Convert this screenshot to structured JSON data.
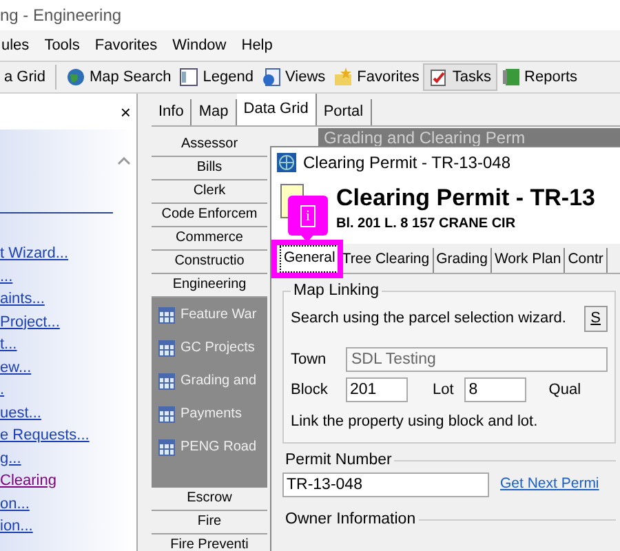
{
  "window": {
    "title": "ng - Engineering"
  },
  "menu": [
    "ules",
    "Tools",
    "Favorites",
    "Window",
    "Help"
  ],
  "toolbar": [
    {
      "label": "a Grid",
      "kind": "partial",
      "selected": false
    },
    {
      "label": "Map Search",
      "kind": "globe",
      "selected": false
    },
    {
      "label": "Legend",
      "kind": "legend",
      "selected": false
    },
    {
      "label": "Views",
      "kind": "views",
      "selected": false
    },
    {
      "label": "Favorites",
      "kind": "star",
      "selected": false
    },
    {
      "label": "Tasks",
      "kind": "tasks",
      "selected": true
    },
    {
      "label": "Reports",
      "kind": "reports",
      "selected": false
    }
  ],
  "side_panel": {
    "close": "×",
    "links": [
      {
        "label": "t Wizard...",
        "visited": false
      },
      {
        "label": "...",
        "visited": false
      },
      {
        "label": "aints...",
        "visited": false
      },
      {
        "label": "Project...",
        "visited": false
      },
      {
        "label": "t...",
        "visited": false
      },
      {
        "label": "ew...",
        "visited": false
      },
      {
        "label": ".",
        "visited": false
      },
      {
        "label": "uest...",
        "visited": false
      },
      {
        "label": "e Requests...",
        "visited": false
      },
      {
        "label": "g...",
        "visited": false
      },
      {
        "label": "Clearing",
        "visited": true
      },
      {
        "label": "on...",
        "visited": false
      },
      {
        "label": "ion...",
        "visited": false
      }
    ]
  },
  "tabs": [
    {
      "label": "Info",
      "selected": false
    },
    {
      "label": "Map",
      "selected": false
    },
    {
      "label": "Data Grid",
      "selected": true
    },
    {
      "label": "Portal",
      "selected": false
    }
  ],
  "modules_top": [
    "Assessor",
    "Bills",
    "Clerk",
    "Code Enforcem",
    "Commerce",
    "Constructio",
    "Engineering"
  ],
  "module_items": [
    "Feature War",
    "GC Projects",
    "Grading and",
    "Payments",
    "PENG Road"
  ],
  "modules_bottom": [
    "Escrow",
    "Fire",
    "Fire Preventi"
  ],
  "grid_title": "Grading and Clearing Perm",
  "dialog": {
    "title": "Clearing Permit - TR-13-048",
    "heading": "Clearing Permit - TR-13",
    "subheading": "Bl. 201 L. 8  157 CRANE CIR",
    "callout": "i",
    "tabs": [
      {
        "label": "General",
        "selected": true
      },
      {
        "label": "Tree Clearing",
        "selected": false
      },
      {
        "label": "Grading",
        "selected": false
      },
      {
        "label": "Work Plan",
        "selected": false
      },
      {
        "label": "Contr",
        "selected": false
      }
    ],
    "map_linking": {
      "legend": "Map Linking",
      "hint": "Search using the parcel selection wizard.",
      "button": "S",
      "town_label": "Town",
      "town": "SDL Testing",
      "block_label": "Block",
      "block": "201",
      "lot_label": "Lot",
      "lot": "8",
      "qual_label": "Qual",
      "note": "Link the property using block and lot."
    },
    "permit": {
      "legend": "Permit Number",
      "value": "TR-13-048",
      "link": "Get Next Permi"
    },
    "owner": {
      "legend": "Owner Information"
    }
  }
}
